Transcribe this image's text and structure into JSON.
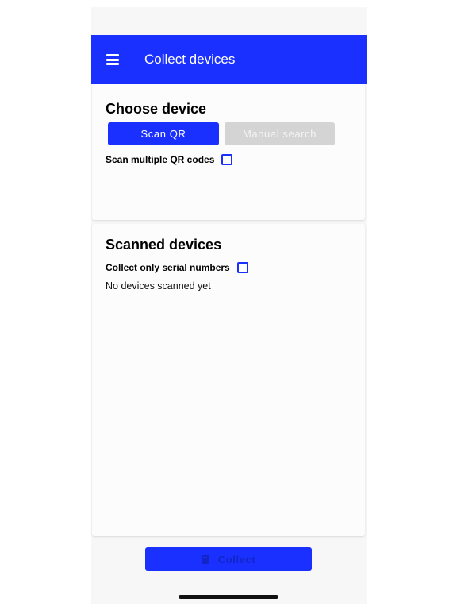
{
  "header": {
    "title": "Collect devices",
    "menu_icon": "hamburger-menu-icon",
    "color": "#1a30ff"
  },
  "choose_device": {
    "title": "Choose device",
    "scan_qr_label": "Scan QR",
    "manual_search_label": "Manual search",
    "scan_multiple_label": "Scan multiple QR codes",
    "scan_multiple_checked": false
  },
  "scanned_devices": {
    "title": "Scanned devices",
    "collect_serial_label": "Collect only serial numbers",
    "collect_serial_checked": false,
    "empty_message": "No devices scanned yet"
  },
  "footer": {
    "collect_label": "Collect",
    "collect_icon": "clipboard-icon"
  },
  "colors": {
    "accent": "#1a30ff",
    "disabled": "#d4d4d4"
  }
}
